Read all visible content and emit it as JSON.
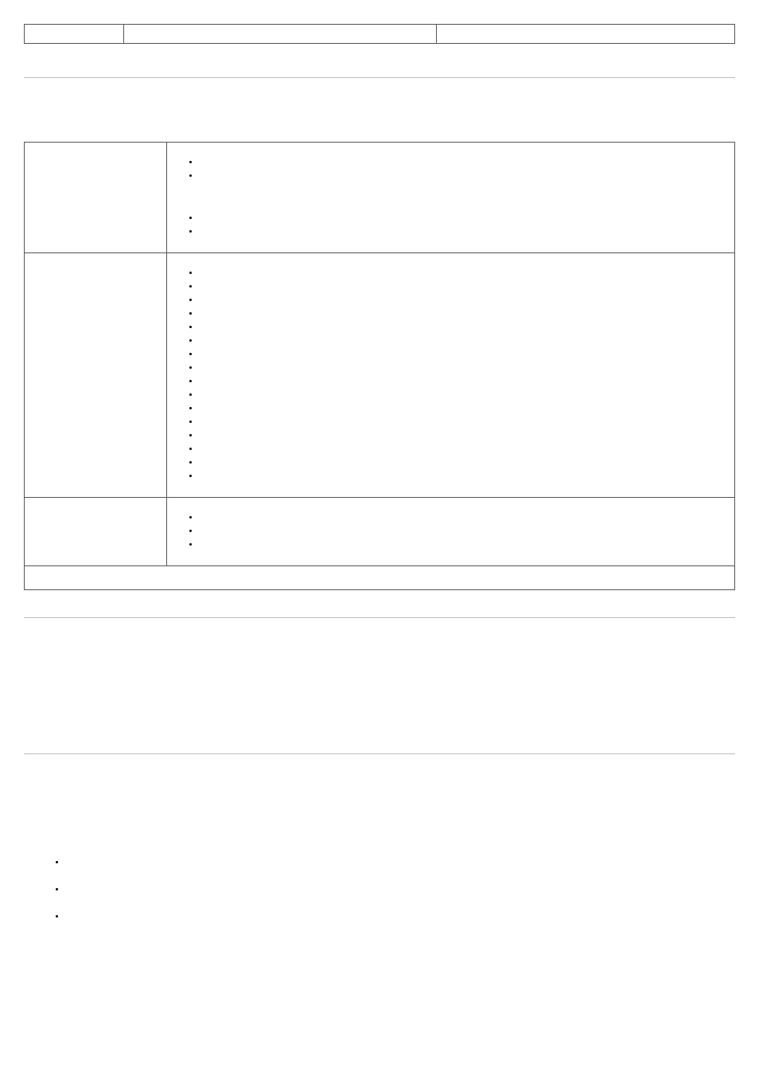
{
  "topRow": {
    "c1": "",
    "c2": "",
    "c3": ""
  },
  "mainTable": {
    "rows": [
      {
        "left": "",
        "right": {
          "groups": [
            {
              "items": [
                "",
                ""
              ]
            },
            {
              "items": [
                "",
                ""
              ]
            }
          ]
        }
      },
      {
        "left": "",
        "right": {
          "groups": [
            {
              "items": [
                "",
                "",
                "",
                "",
                "",
                "",
                "",
                "",
                "",
                "",
                "",
                "",
                "",
                "",
                "",
                ""
              ]
            }
          ]
        }
      },
      {
        "left": "",
        "right": {
          "groups": [
            {
              "items": [
                "",
                "",
                ""
              ]
            }
          ]
        }
      }
    ],
    "lastRow": ""
  },
  "bottomList": [
    "",
    "",
    ""
  ]
}
